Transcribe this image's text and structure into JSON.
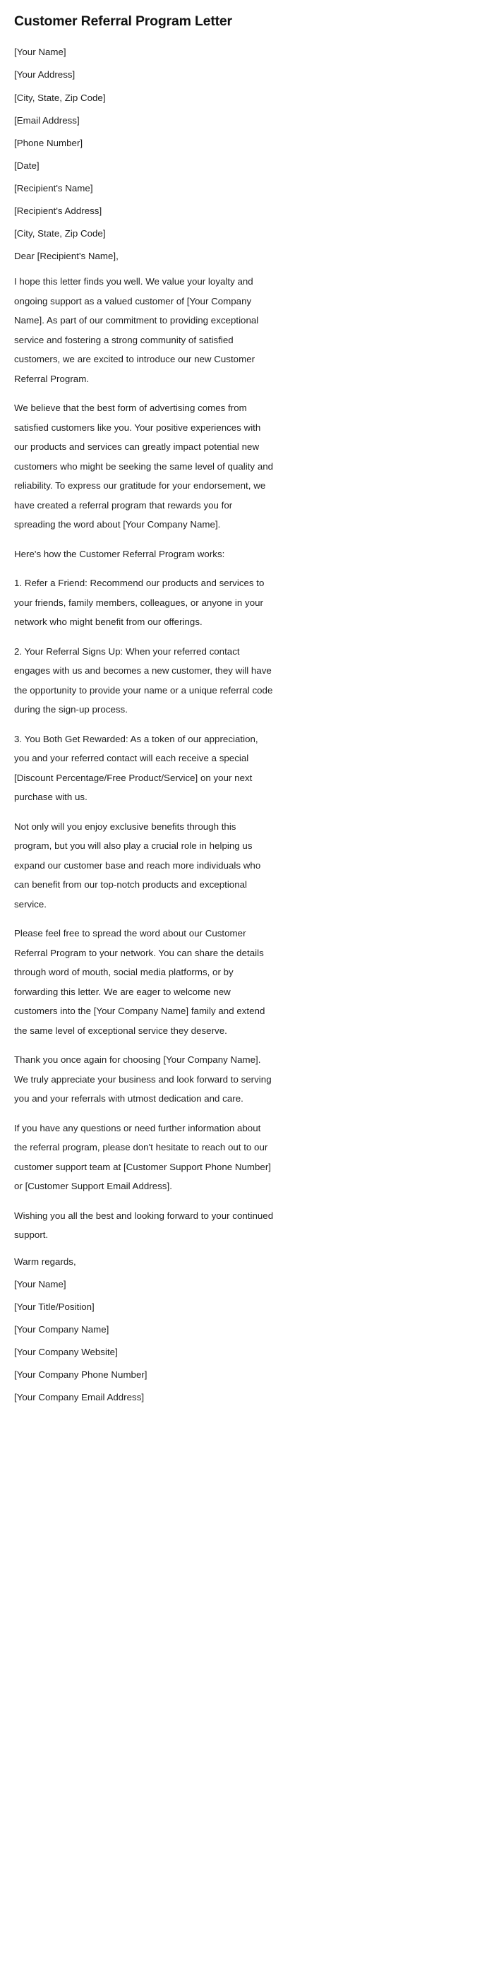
{
  "document": {
    "title": "Customer Referral Program Letter",
    "sender_block": [
      "[Your Name]",
      "[Your Address]",
      "[City, State, Zip Code]",
      "[Email Address]",
      "[Phone Number]"
    ],
    "date_line": "[Date]",
    "recipient_block": [
      "[Recipient's Name]",
      "[Recipient's Address]",
      "[City, State, Zip Code]"
    ],
    "salutation": "Dear [Recipient's Name],",
    "paragraphs": [
      "I hope this letter finds you well. We value your loyalty and ongoing support as a valued customer of [Your Company Name]. As part of our commitment to providing exceptional service and fostering a strong community of satisfied customers, we are excited to introduce our new Customer Referral Program.",
      "We believe that the best form of advertising comes from satisfied customers like you. Your positive experiences with our products and services can greatly impact potential new customers who might be seeking the same level of quality and reliability. To express our gratitude for your endorsement, we have created a referral program that rewards you for spreading the word about [Your Company Name].",
      "Here's how the Customer Referral Program works:",
      "1. Refer a Friend: Recommend our products and services to your friends, family members, colleagues, or anyone in your network who might benefit from our offerings.",
      "2. Your Referral Signs Up: When your referred contact engages with us and becomes a new customer, they will have the opportunity to provide your name or a unique referral code during the sign-up process.",
      "3. You Both Get Rewarded: As a token of our appreciation, you and your referred contact will each receive a special [Discount Percentage/Free Product/Service] on your next purchase with us.",
      "Not only will you enjoy exclusive benefits through this program, but you will also play a crucial role in helping us expand our customer base and reach more individuals who can benefit from our top-notch products and exceptional service.",
      "Please feel free to spread the word about our Customer Referral Program to your network. You can share the details through word of mouth, social media platforms, or by forwarding this letter. We are eager to welcome new customers into the [Your Company Name] family and extend the same level of exceptional service they deserve.",
      "Thank you once again for choosing [Your Company Name]. We truly appreciate your business and look forward to serving you and your referrals with utmost dedication and care.",
      "If you have any questions or need further information about the referral program, please don't hesitate to reach out to our customer support team at [Customer Support Phone Number] or [Customer Support Email Address].",
      "Wishing you all the best and looking forward to your continued support."
    ],
    "closing": "Warm regards,",
    "signature_block": [
      "[Your Name]",
      "[Your Title/Position]",
      "[Your Company Name]",
      "[Your Company Website]",
      "[Your Company Phone Number]",
      "[Your Company Email Address]"
    ]
  }
}
